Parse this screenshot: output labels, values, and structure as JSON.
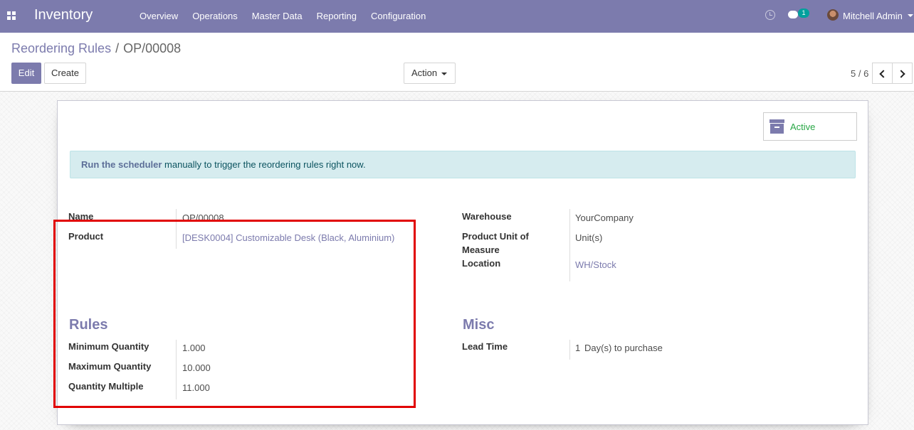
{
  "navbar": {
    "app_name": "Inventory",
    "menu": [
      "Overview",
      "Operations",
      "Master Data",
      "Reporting",
      "Configuration"
    ],
    "chat_count": "1",
    "user_name": "Mitchell Admin"
  },
  "control_panel": {
    "breadcrumb_parent": "Reordering Rules",
    "breadcrumb_separator": "/",
    "breadcrumb_current": "OP/00008",
    "edit_label": "Edit",
    "create_label": "Create",
    "action_label": "Action",
    "pager_value": "5 / 6"
  },
  "sheet": {
    "active_label": "Active",
    "alert_link": "Run the scheduler",
    "alert_text": " manually to trigger the reordering rules right now.",
    "fields_left": {
      "name_label": "Name",
      "name_value": "OP/00008",
      "product_label": "Product",
      "product_value": "[DESK0004] Customizable Desk (Black, Aluminium)"
    },
    "fields_right": {
      "warehouse_label": "Warehouse",
      "warehouse_value": "YourCompany",
      "uom_label_line1": "Product Unit of",
      "uom_label_line2": "Measure",
      "uom_value": "Unit(s)",
      "location_label": "Location",
      "location_value": "WH/Stock"
    },
    "rules": {
      "title": "Rules",
      "min_label": "Minimum Quantity",
      "min_value": "1.000",
      "max_label": "Maximum Quantity",
      "max_value": "10.000",
      "multiple_label": "Quantity Multiple",
      "multiple_value": "11.000"
    },
    "misc": {
      "title": "Misc",
      "lead_time_label": "Lead Time",
      "lead_time_value": "1",
      "lead_time_unit": "Day(s) to purchase"
    }
  },
  "colors": {
    "brand": "#7c7bad",
    "highlight": "#e10000",
    "active": "#28a745"
  }
}
